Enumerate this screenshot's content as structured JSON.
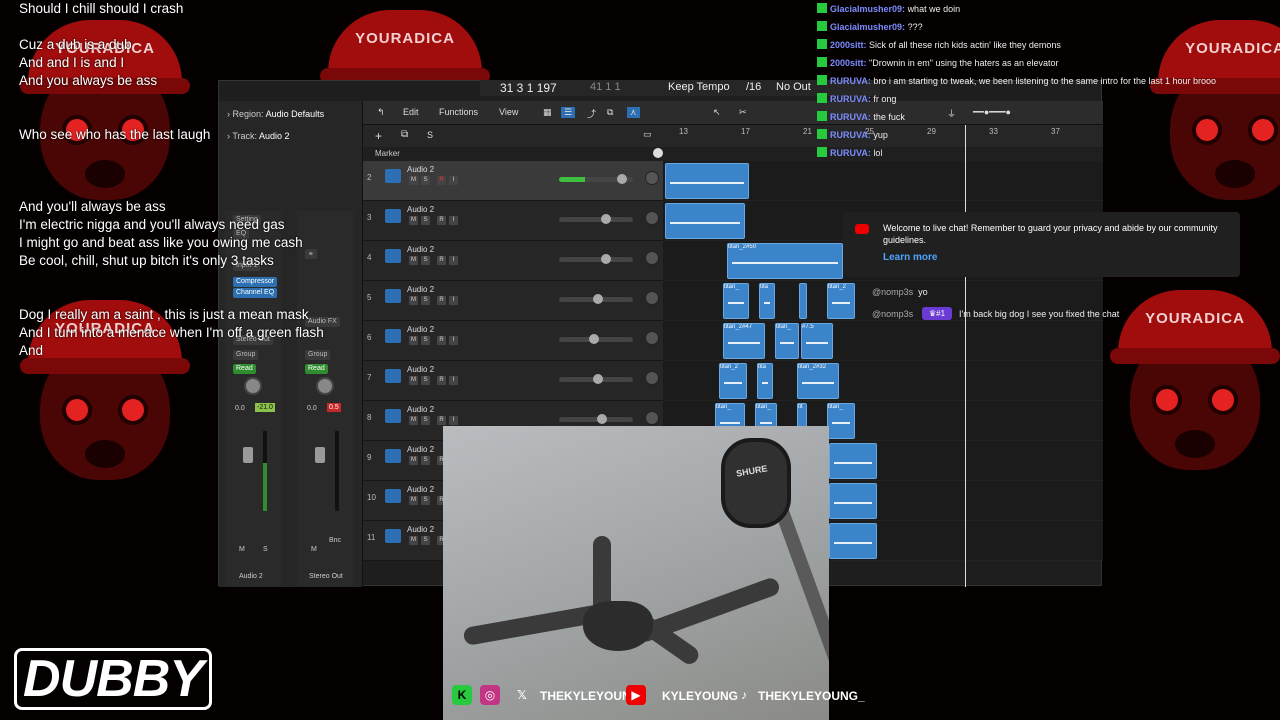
{
  "lyrics": [
    "Should I chill should I crash",
    "",
    "Cuz a dub is a dub",
    "And and I is and I",
    "And you always be ass",
    "",
    "",
    "Who see who has the last laugh",
    "",
    "",
    "",
    "And you'll always be ass",
    "I'm electric nigga and you'll always need gas",
    "I might go and beat ass like you owing me cash",
    "Be cool, chill, shut up bitch it's only 3 tasks",
    "",
    "",
    "Dog I really am a saint , this is just a mean mask",
    "And I turn into a menace when I'm off a green flash",
    "And"
  ],
  "background": {
    "brand": "YOURADICA"
  },
  "transport": {
    "position": "31  3  1  197",
    "position2": "41  1  1",
    "mode": "Keep Tempo",
    "division": "/16",
    "output": "No Out"
  },
  "inspector": {
    "region_label": "Region:",
    "region_value": "Audio Defaults",
    "track_label": "Track:",
    "track_value": "Audio 2",
    "setting": "Setting",
    "eq": "EQ",
    "input": "Input 1",
    "compressor": "Compressor",
    "channel_eq": "Channel EQ",
    "audio_fx": "Audio FX",
    "stereo_out": "Stereo Out",
    "group": "Group",
    "read": "Read",
    "strip1": {
      "vol": "0.0",
      "peak": "-21.0",
      "name": "Audio 2",
      "m": "M",
      "s": "S"
    },
    "strip2": {
      "vol": "0.0",
      "peak": "0.5",
      "name": "Stereo Out",
      "m": "M",
      "bnc": "Bnc"
    }
  },
  "toolbar": {
    "edit": "Edit",
    "functions": "Functions",
    "view": "View"
  },
  "marker_label": "Marker",
  "ruler": [
    "13",
    "17",
    "21",
    "25",
    "29",
    "33",
    "37"
  ],
  "tracks": [
    {
      "num": "2",
      "name": "Audio 2",
      "selected": true
    },
    {
      "num": "3",
      "name": "Audio 2"
    },
    {
      "num": "4",
      "name": "Audio 2"
    },
    {
      "num": "5",
      "name": "Audio 2"
    },
    {
      "num": "6",
      "name": "Audio 2"
    },
    {
      "num": "7",
      "name": "Audio 2"
    },
    {
      "num": "8",
      "name": "Audio 2"
    },
    {
      "num": "9",
      "name": "Audio 2"
    },
    {
      "num": "10",
      "name": "Audio 2"
    },
    {
      "num": "11",
      "name": "Audio 2"
    }
  ],
  "track_buttons": {
    "m": "M",
    "s": "S",
    "r": "R",
    "i": "I"
  },
  "regions": {
    "r4": "titan_2#50",
    "r5a": "titan_",
    "r5b": "tita",
    "r5c": "titan_2",
    "r6a": "titan_2#47",
    "r6b": "titan_",
    "r6c": "#7.5",
    "r7a": "titan_2",
    "r7b": "tita",
    "r7c": "titan_2#32",
    "r8a": "titan_",
    "r8b": "titan_",
    "r8c": "tit",
    "r8d": "titan_"
  },
  "chat": [
    {
      "user": "Glacialmusher09:",
      "text": "what we doin"
    },
    {
      "user": "Glacialmusher09:",
      "text": "???"
    },
    {
      "user": "2000sitt:",
      "text": "Sick of all these rich kids actin' like they demons"
    },
    {
      "user": "2000sitt:",
      "text": "\"Drownin in em\" using the haters as an elevator"
    },
    {
      "user": "RURUVA:",
      "text": "bro i am starting to tweak, we been listening to the same intro for the last 1 hour brooo"
    },
    {
      "user": "RURUVA:",
      "text": "fr ong"
    },
    {
      "user": "RURUVA:",
      "text": "the fuck"
    },
    {
      "user": "RURUVA:",
      "text": "yup"
    },
    {
      "user": "RURUVA:",
      "text": "lol"
    }
  ],
  "toast": {
    "text": "Welcome to live chat! Remember to guard your privacy and abide by our community guidelines.",
    "link": "Learn more"
  },
  "yt_chat": [
    {
      "user": "@nomp3s",
      "text": "yo"
    },
    {
      "user": "@nomp3s",
      "badge": "#1",
      "text": "I'm back big dog I see you fixed the chat"
    }
  ],
  "socials": {
    "x": "THEKYLEYOUNG",
    "youtube": "KYLEYOUNG",
    "tiktok": "THEKYLEYOUNG_"
  },
  "mic_brand": "SHURE",
  "logo": "DUBBY",
  "colors": {
    "accent_red": "#e52222",
    "region_blue": "#3b84c9",
    "kick_green": "#27c93f",
    "chat_user": "#7b8cff"
  }
}
